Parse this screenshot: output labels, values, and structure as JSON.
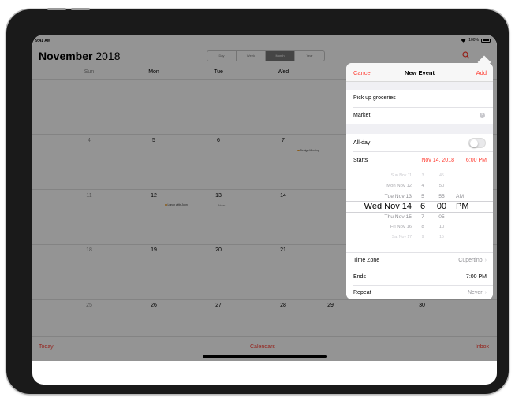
{
  "status_bar": {
    "time": "9:41 AM",
    "battery": "100%"
  },
  "calendar": {
    "month": "November",
    "year": "2018",
    "view_tabs": [
      "Day",
      "Week",
      "Month",
      "Year"
    ],
    "active_view": "Month",
    "days_of_week": [
      "Sun",
      "Mon",
      "Tue",
      "Wed"
    ],
    "weeks": [
      [
        "4",
        "5",
        "6",
        "7"
      ],
      [
        "11",
        "12",
        "13",
        "14"
      ],
      [
        "18",
        "19",
        "20",
        "21"
      ],
      [
        "25",
        "26",
        "27",
        "28",
        "29",
        "30"
      ]
    ],
    "events": {
      "design_meeting": "Design Meeting",
      "lunch": "Lunch with John",
      "lunch_sub": "Noon"
    },
    "toolbar": {
      "today": "Today",
      "calendars": "Calendars",
      "inbox": "Inbox"
    }
  },
  "popover": {
    "cancel": "Cancel",
    "title": "New Event",
    "add": "Add",
    "event_title": "Pick up groceries",
    "location": "Market",
    "all_day_label": "All-day",
    "all_day_on": false,
    "starts_label": "Starts",
    "starts_date": "Nov 14, 2018",
    "starts_time": "6:00 PM",
    "picker": {
      "rows": [
        {
          "date": "Sun Nov 11",
          "hour": "3",
          "min": "45",
          "ampm": ""
        },
        {
          "date": "Mon Nov 12",
          "hour": "4",
          "min": "50",
          "ampm": ""
        },
        {
          "date": "Tue Nov 13",
          "hour": "5",
          "min": "55",
          "ampm": "AM"
        },
        {
          "date": "Wed Nov 14",
          "hour": "6",
          "min": "00",
          "ampm": "PM"
        },
        {
          "date": "Thu Nov 15",
          "hour": "7",
          "min": "05",
          "ampm": ""
        },
        {
          "date": "Fri Nov 16",
          "hour": "8",
          "min": "10",
          "ampm": ""
        },
        {
          "date": "Sat Nov 17",
          "hour": "9",
          "min": "15",
          "ampm": ""
        }
      ],
      "selected_index": 3
    },
    "time_zone_label": "Time Zone",
    "time_zone_value": "Cupertino",
    "ends_label": "Ends",
    "ends_value": "7:00 PM",
    "repeat_label": "Repeat",
    "repeat_value": "Never"
  },
  "colors": {
    "accent": "#ff3b30",
    "event_dot": "#f0a030"
  }
}
